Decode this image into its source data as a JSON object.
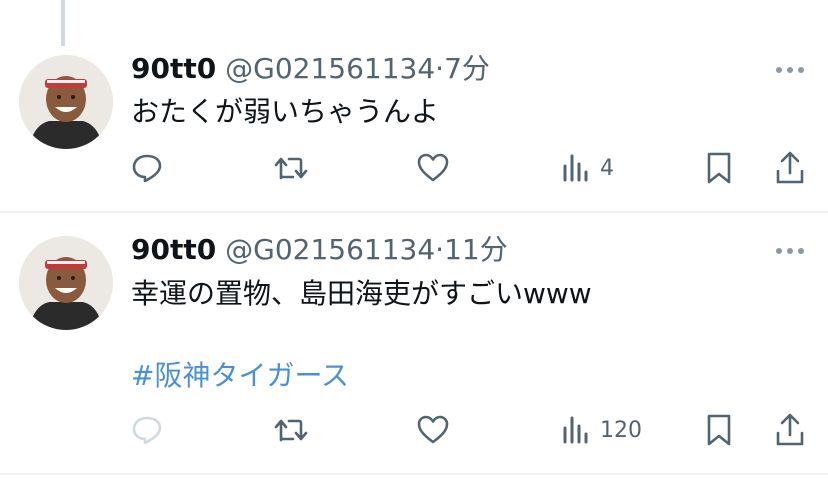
{
  "tweets": [
    {
      "display_name": "90tt0",
      "handle": "@G021561134",
      "separator": "·",
      "time": "7分",
      "text": "おたくが弱いちゃうんよ",
      "hashtag": "",
      "views": "4"
    },
    {
      "display_name": "90tt0",
      "handle": "@G021561134",
      "separator": "·",
      "time": "11分",
      "text": "幸運の置物、島田海吏がすごいwww",
      "hashtag": "#阪神タイガース",
      "views": "120"
    }
  ],
  "icons": {
    "reply": "reply-icon",
    "retweet": "retweet-icon",
    "like": "heart-icon",
    "views": "views-icon",
    "bookmark": "bookmark-icon",
    "share": "share-icon",
    "more": "more-icon"
  },
  "colors": {
    "text": "#0f1419",
    "secondary": "#536471",
    "hashtag": "#4a90d6",
    "divider": "#eff3f4"
  }
}
